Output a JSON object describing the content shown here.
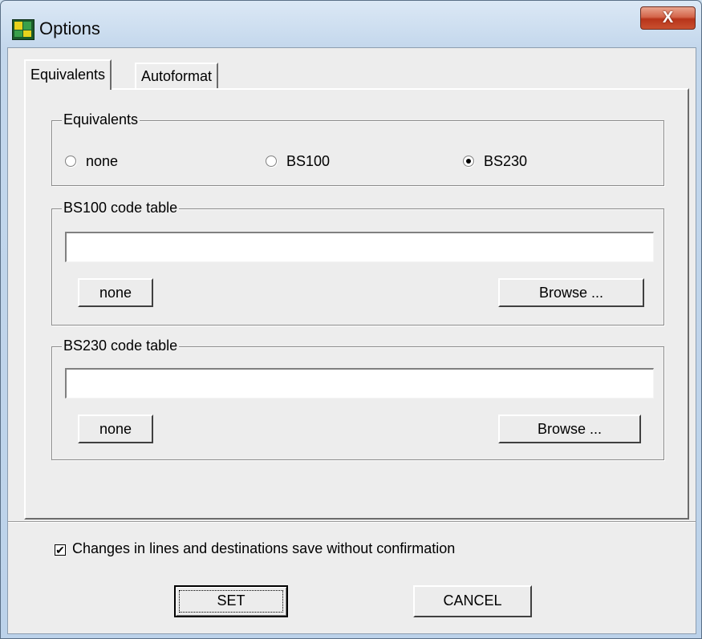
{
  "window": {
    "title": "Options",
    "close_label": "X"
  },
  "tabs": [
    {
      "label": "Equivalents"
    },
    {
      "label": "Autoformat"
    }
  ],
  "equivalents_group": {
    "label": "Equivalents",
    "options": [
      {
        "label": "none",
        "checked": false
      },
      {
        "label": "BS100",
        "checked": false
      },
      {
        "label": "BS230",
        "checked": true
      }
    ]
  },
  "bs100_group": {
    "label": "BS100 code table",
    "value": "",
    "none_label": "none",
    "browse_label": "Browse ..."
  },
  "bs230_group": {
    "label": "BS230 code table",
    "value": "",
    "none_label": "none",
    "browse_label": "Browse ..."
  },
  "save_without_confirmation": {
    "label": "Changes in lines and destinations save without confirmation",
    "checked": true,
    "check_glyph": "✔"
  },
  "buttons": {
    "set_label": "SET",
    "cancel_label": "CANCEL"
  }
}
